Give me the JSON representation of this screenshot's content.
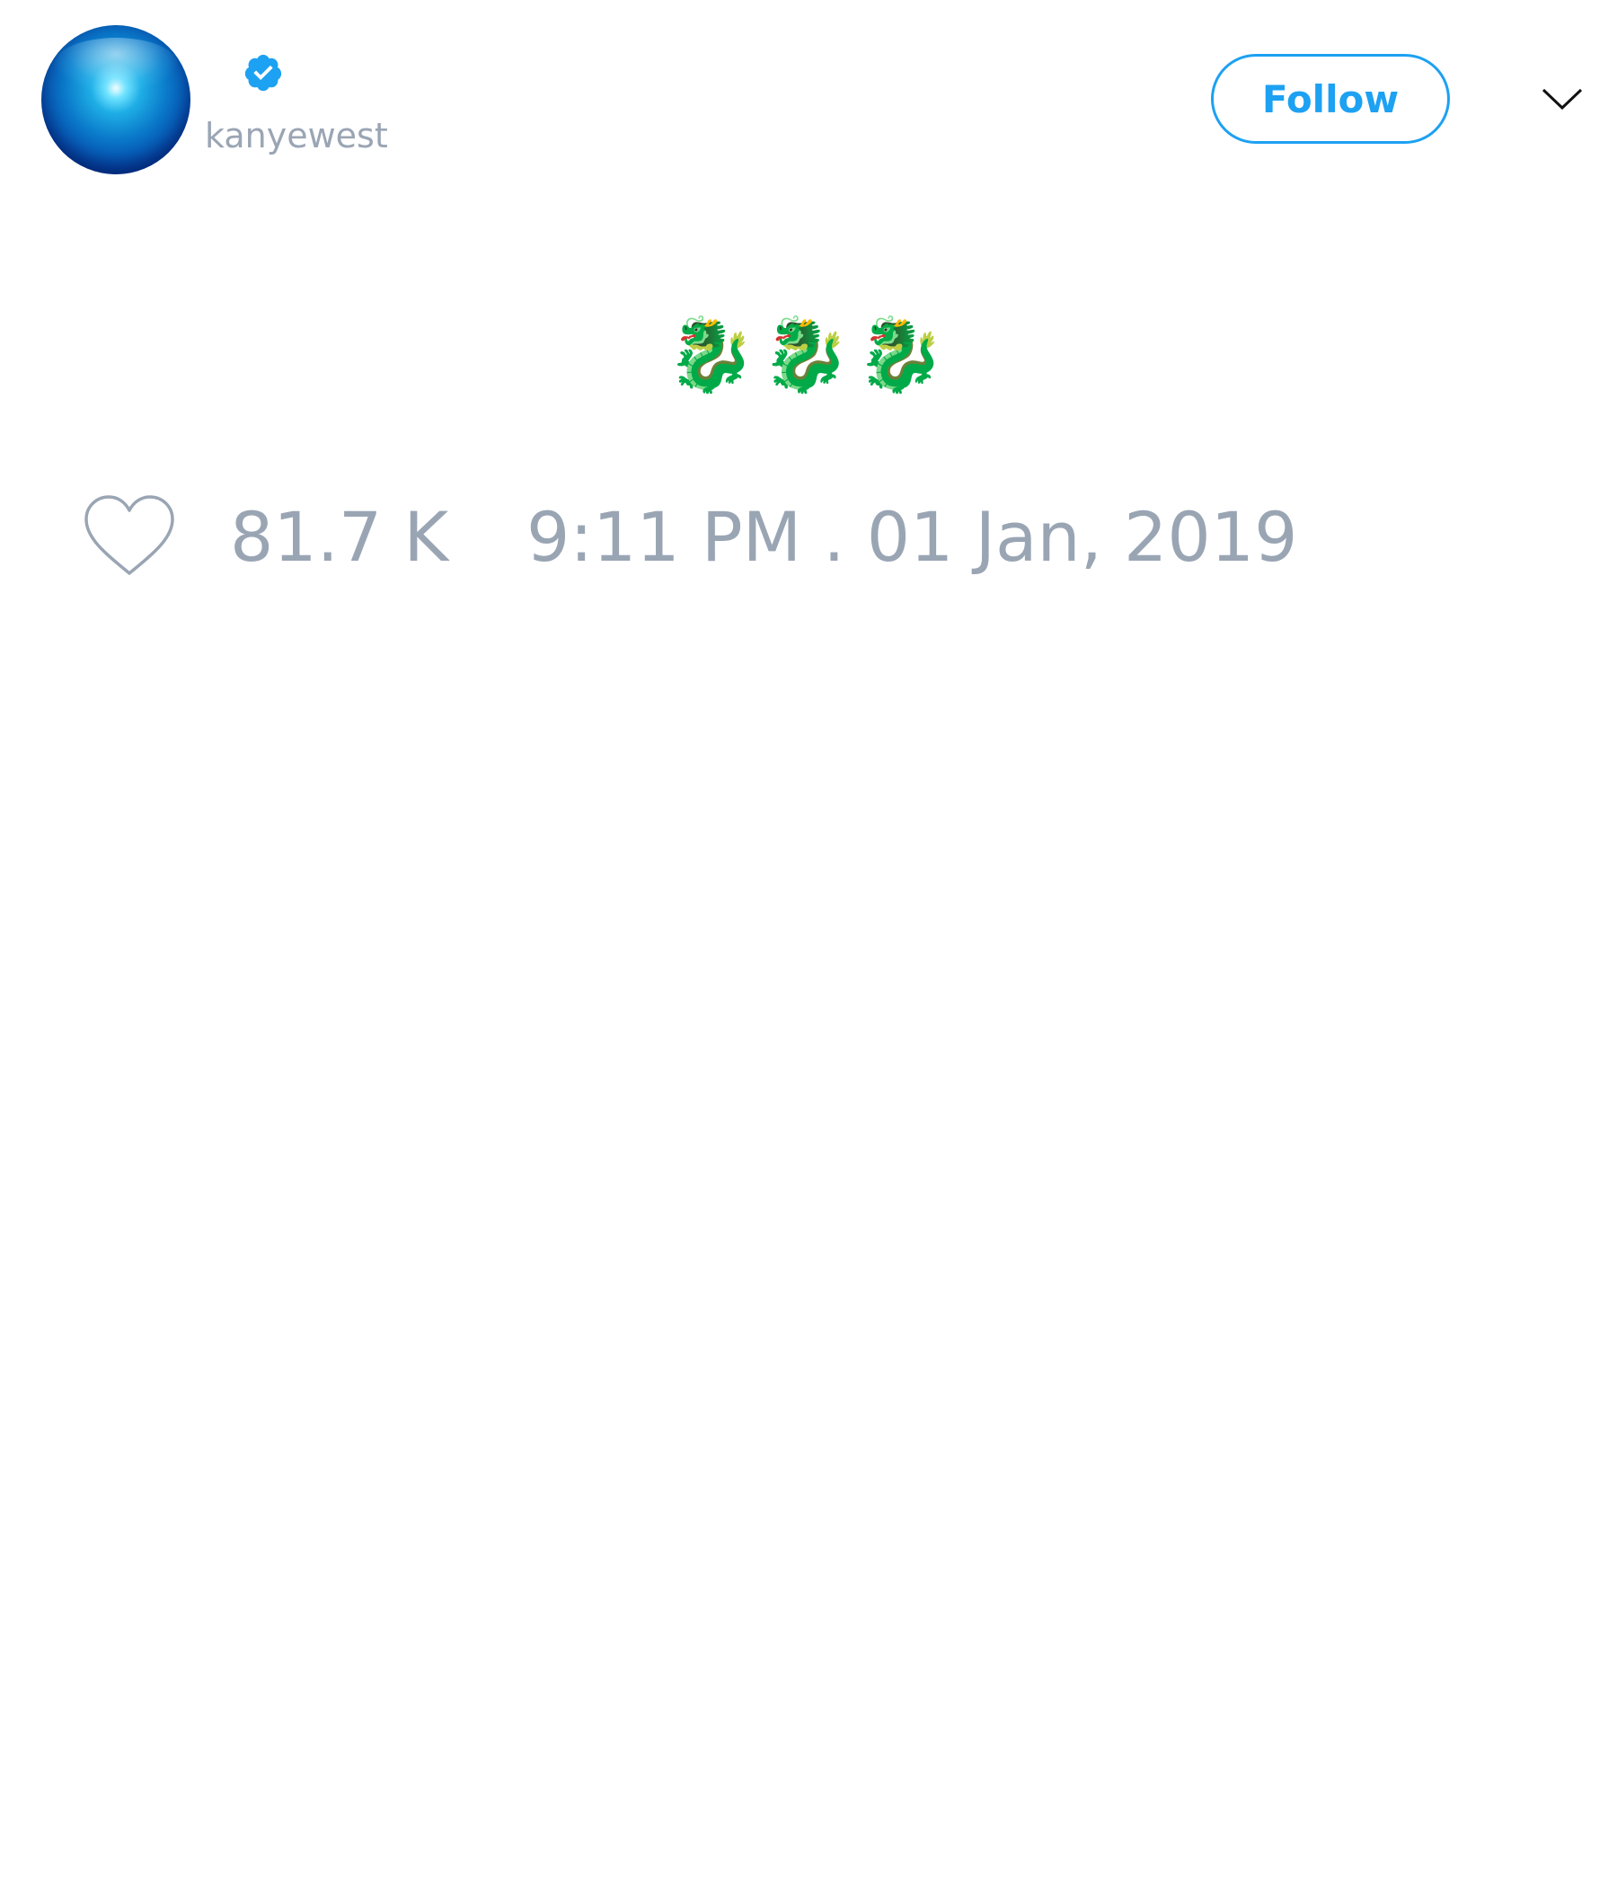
{
  "header": {
    "username": "kanyewest",
    "verified_icon": "verified-badge-icon",
    "follow_label": "Follow",
    "menu_icon": "chevron-down-icon"
  },
  "tweet": {
    "text": "🐉🐉🐉"
  },
  "footer": {
    "like_icon": "heart-icon",
    "like_count": "81.7 K",
    "timestamp": "9:11 PM . 01 Jan, 2019"
  },
  "colors": {
    "accent": "#1da1f2",
    "muted_text": "#9aa5b4",
    "background": "#ffffff"
  }
}
